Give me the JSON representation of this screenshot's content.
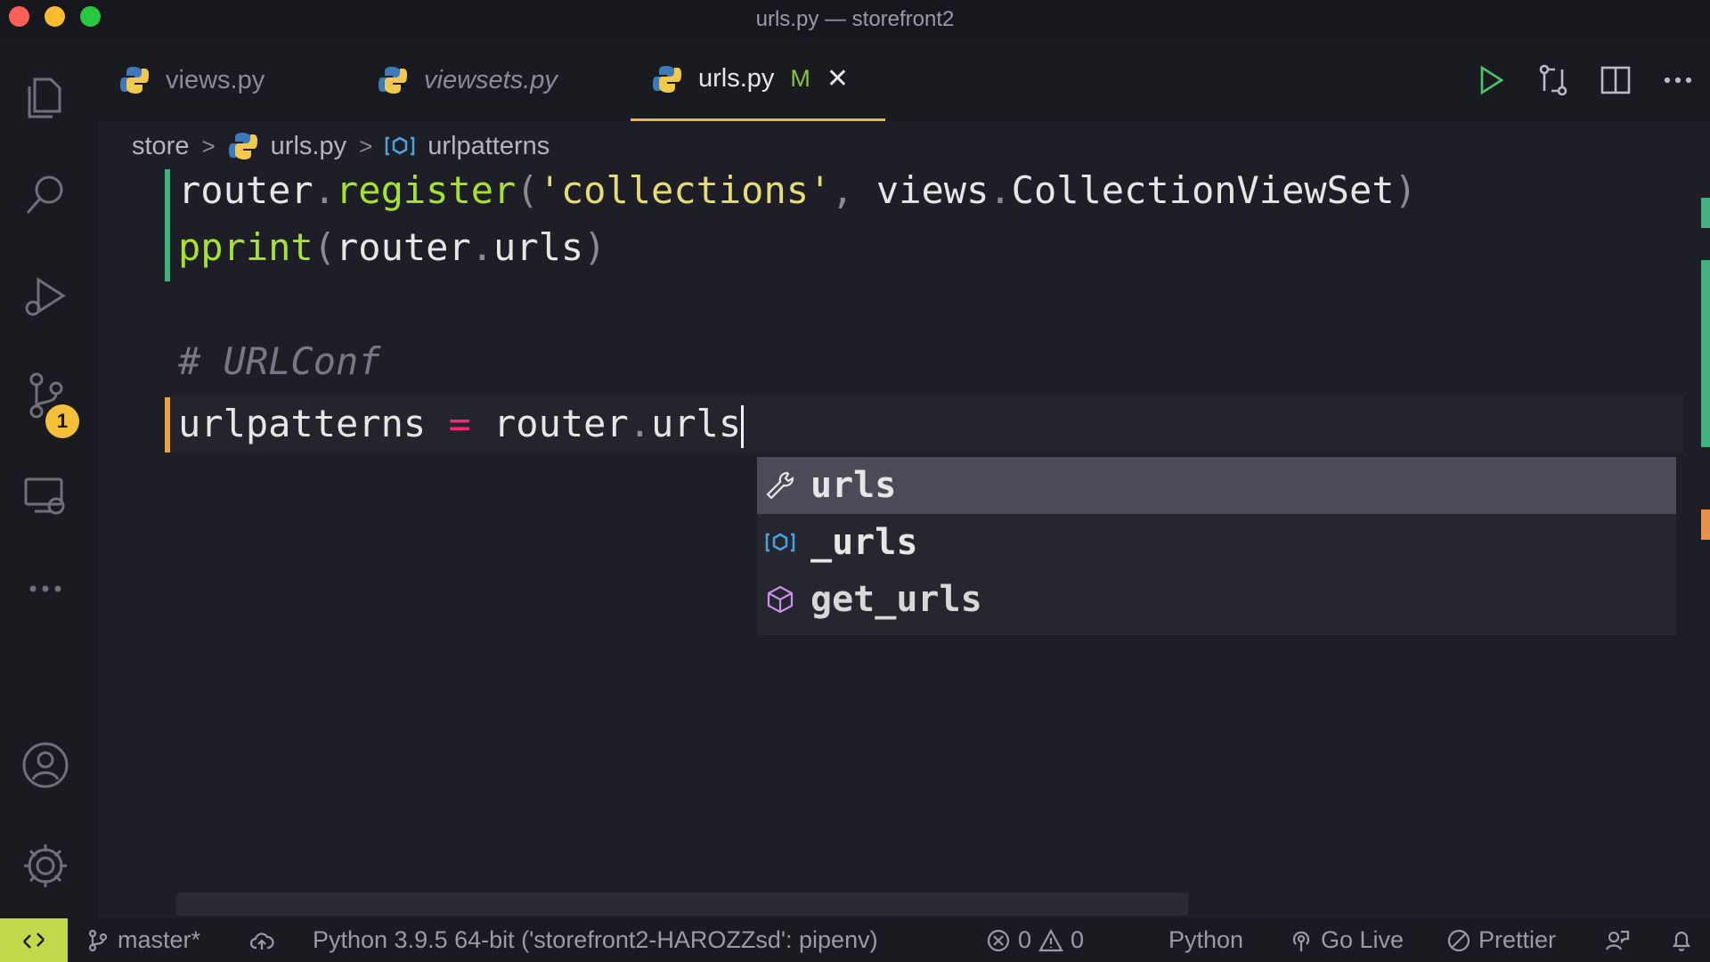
{
  "window": {
    "title": "urls.py — storefront2"
  },
  "tabs": [
    {
      "label": "views.py",
      "italic": false
    },
    {
      "label": "viewsets.py",
      "italic": true
    },
    {
      "label": "urls.py",
      "modified": "M",
      "close": "✕"
    }
  ],
  "breadcrumb": {
    "folder": "store",
    "file": "urls.py",
    "symbol": "urlpatterns"
  },
  "activity": {
    "source_control_badge": "1"
  },
  "editor": {
    "line1": {
      "a": "router",
      "b": ".",
      "c": "register",
      "d": "(",
      "e": "'collections'",
      "f": ", ",
      "g": "views",
      "h": ".",
      "i": "CollectionViewSet",
      "j": ")"
    },
    "line2": {
      "a": "pprint",
      "b": "(",
      "c": "router",
      "d": ".",
      "e": "urls",
      "f": ")"
    },
    "line3": {
      "comment": "# URLConf"
    },
    "line4": {
      "a": "urlpatterns",
      "b": " = ",
      "c": "router",
      "d": ".",
      "e": "urls"
    }
  },
  "suggestions": [
    {
      "label": "urls",
      "icon": "wrench-icon"
    },
    {
      "label": "_urls",
      "icon": "variable-icon"
    },
    {
      "label": "get_urls",
      "icon": "cube-icon"
    }
  ],
  "statusbar": {
    "remote_icon": "remote-icon",
    "branch": "master*",
    "interpreter": "Python 3.9.5 64-bit ('storefront2-HAROZZsd': pipenv)",
    "errors": "0",
    "warnings": "0",
    "language": "Python",
    "go_live": "Go Live",
    "prettier": "Prettier"
  },
  "colors": {
    "accent_tab": "#e9b64a",
    "modified": "#8ac53a",
    "function": "#a6e22e",
    "string": "#e6db74",
    "operator": "#f92672",
    "badge": "#f4c03a",
    "remote": "#c2d94b"
  }
}
